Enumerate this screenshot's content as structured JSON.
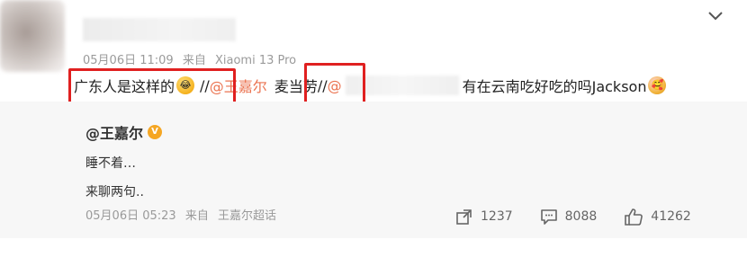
{
  "post": {
    "date": "05月06日 11:09",
    "source_prefix": "来自",
    "source": "Xiaomi 13 Pro",
    "text_start": "广东人是这样的",
    "emoji_laugh": "😂",
    "separator": "//",
    "mention_1": "@王嘉尔",
    "text_mid": "麦当劳",
    "separator_2": "//",
    "mention_2": "@",
    "text_end": "有在云南吃好吃的吗Jackson",
    "emoji_end": "🥰"
  },
  "repost": {
    "author": "@王嘉尔",
    "badge": "V",
    "line1": "睡不着…",
    "line2": "来聊两句..",
    "date": "05月06日 05:23",
    "source_prefix": "来自",
    "source": "王嘉尔超话"
  },
  "actions": {
    "repost_count": "1237",
    "comment_count": "8088",
    "like_count": "41262"
  },
  "icons": {
    "menu": "chevron-down-icon",
    "repost": "share-icon",
    "comment": "comment-icon",
    "like": "thumbs-up-icon"
  },
  "colors": {
    "mention": "#eb7350",
    "highlight_box": "#e02020",
    "repost_bg": "#f7f7f7",
    "badge": "#f5a623"
  }
}
